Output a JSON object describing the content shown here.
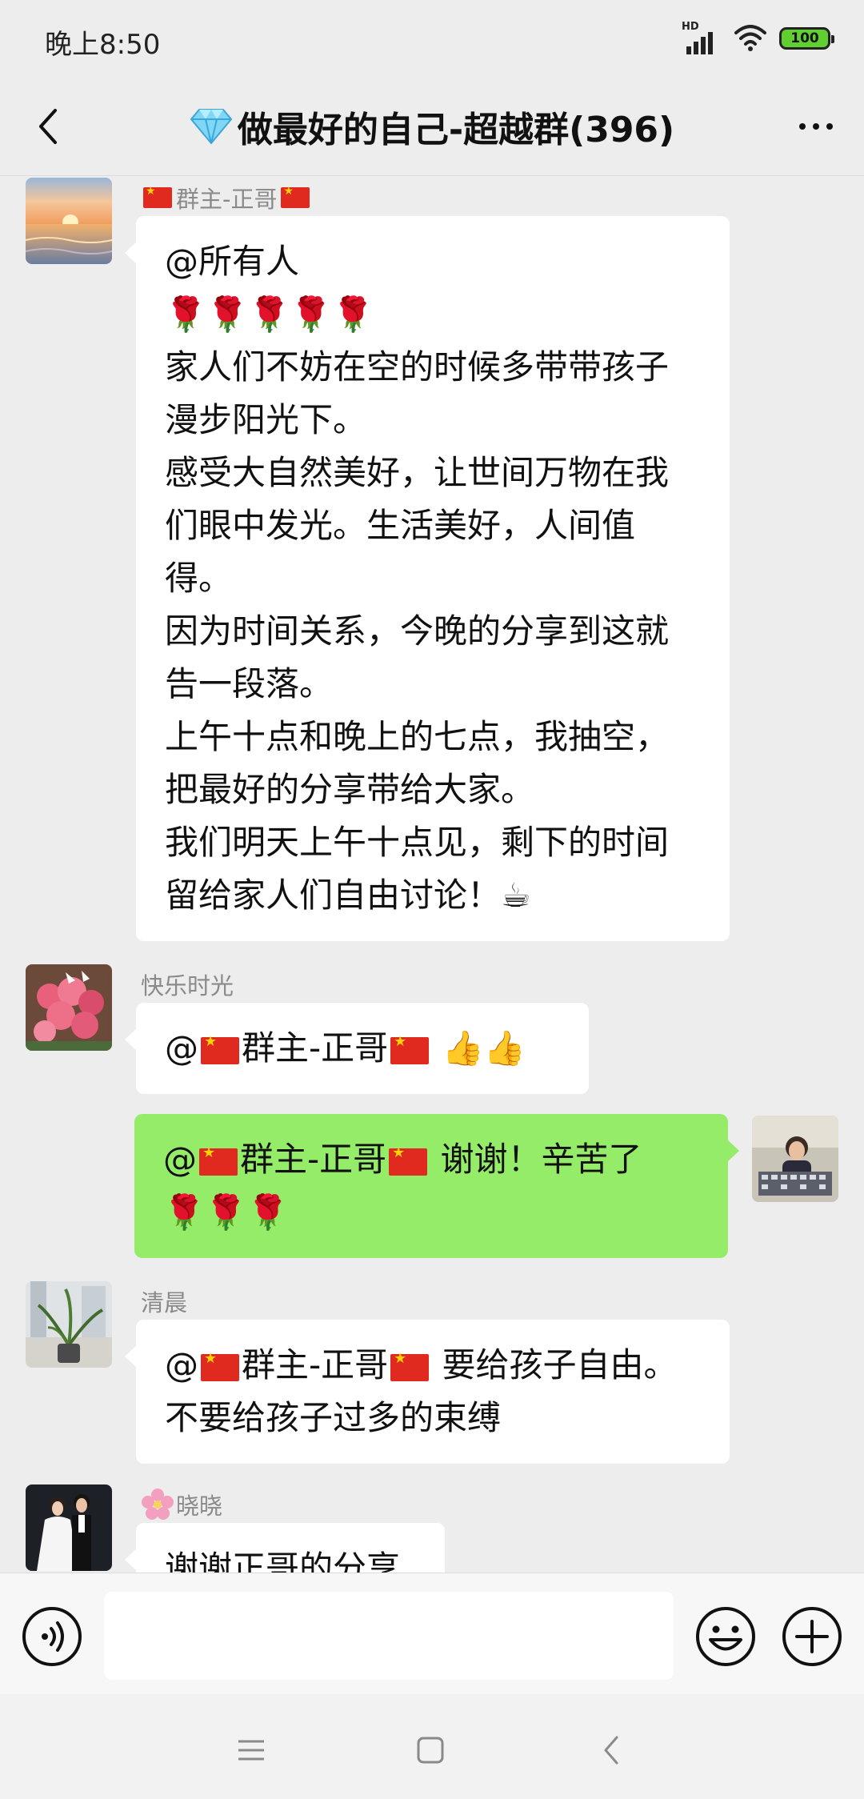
{
  "status_bar": {
    "time": "晚上8:50",
    "signal_label": "HD",
    "battery": "100"
  },
  "header": {
    "title_icon": "diamond-icon",
    "title": "做最好的自己-超越群(396)"
  },
  "messages": [
    {
      "side": "left",
      "sender_name": "群主-正哥",
      "sender_decoration": "china-flag-icon",
      "avatar": "sunset-sea-avatar",
      "lines": [
        "@所有人",
        "🌹🌹🌹🌹🌹",
        "家人们不妨在空的时候多带带孩子",
        "漫步阳光下。",
        "感受大自然美好，让世间万物在我",
        "们眼中发光。生活美好，人间值",
        "得。",
        "因为时间关系，今晚的分享到这就",
        "告一段落。",
        "上午十点和晚上的七点，我抽空，",
        "把最好的分享带给大家。",
        "我们明天上午十点见，剩下的时间",
        "留给家人们自由讨论！☕"
      ]
    },
    {
      "side": "left",
      "sender_name": "快乐时光",
      "avatar": "pink-flowers-avatar",
      "mention": "@",
      "mention_name": "群主-正哥",
      "text_after": "👍👍"
    },
    {
      "side": "right",
      "avatar": "child-photo-avatar",
      "mention": "@",
      "mention_name": "群主-正哥",
      "text_after": "谢谢！辛苦了",
      "line2": "🌹🌹🌹"
    },
    {
      "side": "left",
      "sender_name": "清晨",
      "avatar": "plant-avatar",
      "mention": "@",
      "mention_name": "群主-正哥",
      "text_after": "要给孩子自由。",
      "line2": "不要给孩子过多的束缚"
    },
    {
      "side": "left",
      "sender_name": "晓晓",
      "sender_decoration": "flower-icon",
      "avatar": "wedding-photo-avatar",
      "lines": [
        "谢谢正哥的分享"
      ]
    }
  ],
  "input_bar": {
    "voice_icon": "voice-icon",
    "input_value": "",
    "emoji_icon": "emoji-icon",
    "plus_icon": "plus-icon"
  },
  "nav_bar": {
    "menu_icon": "menu-icon",
    "home_icon": "home-icon",
    "back_icon": "back-icon"
  },
  "colors": {
    "background": "#ededed",
    "bubble_left": "#ffffff",
    "bubble_right": "#95ec69",
    "sender_text": "#8a8a8a",
    "battery_fill": "#5fd02f"
  }
}
